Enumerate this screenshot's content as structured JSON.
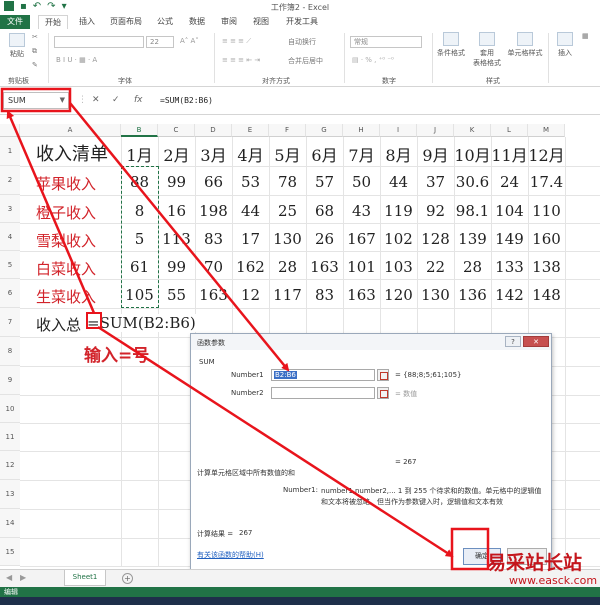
{
  "window": {
    "title": "工作簿2 - Excel"
  },
  "ribbon": {
    "tabs": [
      "文件",
      "开始",
      "插入",
      "页面布局",
      "公式",
      "数据",
      "审阅",
      "视图",
      "开发工具"
    ],
    "active_tab": "开始",
    "paste_label": "粘贴",
    "font_size": "22",
    "wrap_text": "自动换行",
    "merge_center": "合并后居中",
    "number_format": "常规",
    "conditional_format": "条件格式",
    "format_as_table": "套用\n表格格式",
    "cell_styles": "单元格样式",
    "insert_label": "插入",
    "groups": [
      "剪贴板",
      "字体",
      "对齐方式",
      "数字",
      "样式"
    ]
  },
  "formula_bar": {
    "name_box": "SUM",
    "fx": "fx",
    "formula": "=SUM(B2:B6)"
  },
  "sheet": {
    "columns": [
      "A",
      "B",
      "C",
      "D",
      "E",
      "F",
      "G",
      "H",
      "I",
      "J",
      "K",
      "L",
      "M"
    ],
    "rows": [
      "1",
      "2",
      "3",
      "4",
      "5",
      "6",
      "7",
      "8",
      "9",
      "10",
      "11",
      "12",
      "13",
      "14",
      "15"
    ],
    "title": "收入清单",
    "months": [
      "1月",
      "2月",
      "3月",
      "4月",
      "5月",
      "6月",
      "7月",
      "8月",
      "9月",
      "10月",
      "11月",
      "12月"
    ],
    "items": [
      {
        "label": "苹果收入",
        "values": [
          "88",
          "99",
          "66",
          "53",
          "78",
          "57",
          "50",
          "44",
          "37",
          "30.6",
          "24",
          "17.4"
        ]
      },
      {
        "label": "橙子收入",
        "values": [
          "8",
          "16",
          "198",
          "44",
          "25",
          "68",
          "43",
          "119",
          "92",
          "98.1",
          "104",
          "110"
        ]
      },
      {
        "label": "雪梨收入",
        "values": [
          "5",
          "113",
          "83",
          "17",
          "130",
          "26",
          "167",
          "102",
          "128",
          "139",
          "149",
          "160"
        ]
      },
      {
        "label": "白菜收入",
        "values": [
          "61",
          "99",
          "70",
          "162",
          "28",
          "163",
          "101",
          "103",
          "22",
          "28",
          "133",
          "138"
        ]
      },
      {
        "label": "生菜收入",
        "values": [
          "105",
          "55",
          "163",
          "12",
          "117",
          "83",
          "163",
          "120",
          "130",
          "136",
          "142",
          "148"
        ]
      }
    ],
    "total_label": "收入总",
    "total_formula": "=SUM(B2:B6)"
  },
  "annotation": {
    "text": "输入=号",
    "color": "#d2232a"
  },
  "dialog": {
    "title": "函数参数",
    "function_name": "SUM",
    "number1_label": "Number1",
    "number1_value": "B2:B6",
    "number1_result": "= {88;8;5;61;105}",
    "number2_label": "Number2",
    "number2_result": "= 数值",
    "total": "= 267",
    "description": "计算单元格区域中所有数值的和",
    "arg_help_label": "Number1:",
    "arg_help_line1": "number1,number2,... 1 到 255 个待求和的数值。单元格中的逻辑值",
    "arg_help_line2": "和文本将被忽略。但当作为参数键入时，逻辑值和文本有效",
    "result_label": "计算结果 =",
    "result_value": "267",
    "help_link": "有关该函数的帮助(H)",
    "ok_label": "确定",
    "help_btn": "?"
  },
  "sheet_tabs": {
    "name": "Sheet1",
    "add": "+"
  },
  "status": {
    "mode": "编辑"
  },
  "watermark": {
    "main": "易采站长站",
    "url": "www.easck.com"
  },
  "colors": {
    "excel_green": "#217346",
    "label_red": "#d2232a",
    "highlight_red": "#e8141c"
  }
}
